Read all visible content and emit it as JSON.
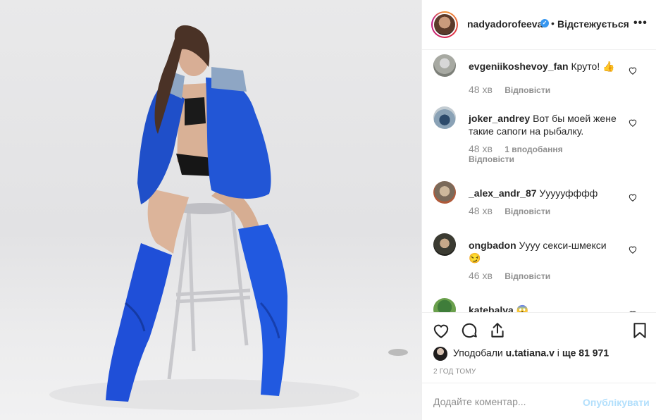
{
  "post": {
    "username": "nadyadorofeeva",
    "verified_icon": "verified-badge-icon",
    "separator": "•",
    "follow_status": "Відстежується",
    "more": "•••"
  },
  "comments": [
    {
      "username": "evgeniikoshevoy_fan",
      "text": "Круто! 👍",
      "time": "48 хв",
      "likes": "",
      "reply": "Відповісти"
    },
    {
      "username": "joker_andrey",
      "text": "Вот бы моей жене такие сапоги на рыбалку.",
      "time": "48 хв",
      "likes": "1 вподобання",
      "reply": "Відповісти"
    },
    {
      "username": "_alex_andr_87",
      "text": "Уууууфффф",
      "time": "48 хв",
      "likes": "",
      "reply": "Відповісти"
    },
    {
      "username": "ongbadon",
      "text": "Уууу секси-шмекси 😏",
      "time": "46 хв",
      "likes": "",
      "reply": "Відповісти"
    },
    {
      "username": "katebalva",
      "text": "😱",
      "time": "",
      "likes": "",
      "reply": ""
    }
  ],
  "actions": {
    "like_icon": "heart-icon",
    "comment_icon": "comment-icon",
    "share_icon": "share-icon",
    "save_icon": "bookmark-icon"
  },
  "likes": {
    "prefix": "Уподобали",
    "user": "u.tatiana.v",
    "middle": "і",
    "count_text": "ще 81 971"
  },
  "timestamp": "2 ГОД ТОМУ",
  "add_comment": {
    "placeholder": "Додайте коментар...",
    "post_label": "Опублікувати"
  },
  "colors": {
    "accent_disabled": "#b2dffc",
    "verified": "#3897f0",
    "muted_text": "#8e8e8e",
    "jacket_blue": "#1f4fc9"
  }
}
